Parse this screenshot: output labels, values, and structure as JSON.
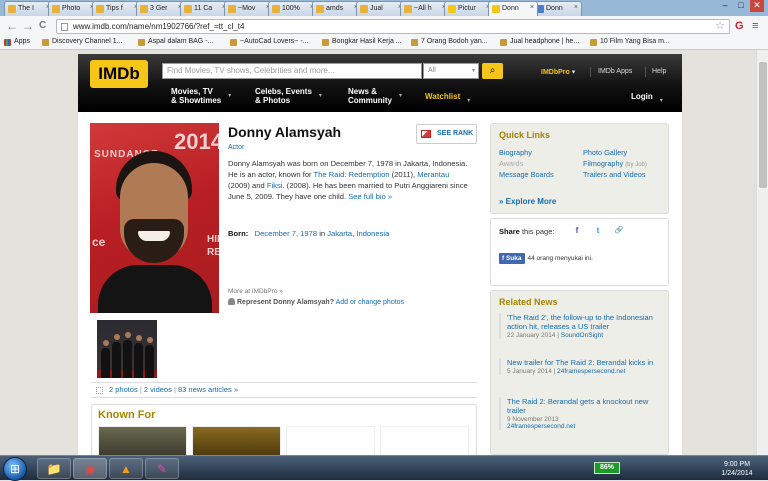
{
  "browser": {
    "tabs": [
      {
        "label": "The I",
        "fav_color": "#e8b13a"
      },
      {
        "label": "Photo",
        "fav_color": "#e8b13a"
      },
      {
        "label": "Tips f",
        "fav_color": "#e8b13a"
      },
      {
        "label": "3 Ger",
        "fav_color": "#e8b13a"
      },
      {
        "label": "11 Ca",
        "fav_color": "#e8b13a"
      },
      {
        "label": "~Mov",
        "fav_color": "#e8b13a"
      },
      {
        "label": "100%",
        "fav_color": "#e8b13a"
      },
      {
        "label": "amds",
        "fav_color": "#e8b13a"
      },
      {
        "label": "Jual",
        "fav_color": "#e8b13a"
      },
      {
        "label": "~All h",
        "fav_color": "#e8b13a"
      },
      {
        "label": "Pictur",
        "fav_color": "#f5c518"
      },
      {
        "label": "Donn",
        "fav_color": "#f5c518"
      },
      {
        "label": "Donn",
        "fav_color": "#4a7fd0"
      }
    ],
    "tab_close": "×",
    "active_tab": 11,
    "window_controls": {
      "minimize": "–",
      "maximize": "□",
      "close": "✕"
    },
    "back": "←",
    "forward": "→",
    "reload": "C",
    "url": "www.imdb.com/name/nm1902766/?ref_=tt_cl_t4",
    "star": "☆",
    "ext_icon": "G",
    "menu_icon": "≡",
    "bookmarks": [
      {
        "label": "Apps"
      },
      {
        "label": "Discovery Channel 1..."
      },
      {
        "label": "Aspal dalam BAG -..."
      },
      {
        "label": "~AutoCad Lovers~ -..."
      },
      {
        "label": "Bongkar Hasil Kerja ..."
      },
      {
        "label": "7 Orang Bodoh yan..."
      },
      {
        "label": "Jual headphone | he..."
      },
      {
        "label": "10 Film Yang Bisa m..."
      }
    ]
  },
  "imdb": {
    "logo": "IMDb",
    "search_placeholder": "Find Movies, TV shows, Celebrities and more...",
    "search_select": "All",
    "search_button": "⌕",
    "imdbpro": "IMDbPro",
    "imdbpro_caret": "▾",
    "apps": "IMDb Apps",
    "help": "Help",
    "nav": [
      {
        "line1": "Movies, TV",
        "line2": "& Showtimes"
      },
      {
        "line1": "Celebs, Events",
        "line2": "& Photos"
      },
      {
        "line1": "News &",
        "line2": "Community"
      }
    ],
    "nav_caret": "▾",
    "watchlist": "Watchlist",
    "login": "Login"
  },
  "person": {
    "name": "Donny Alamsyah",
    "role": "Actor",
    "see_rank": "SEE RANK",
    "bio_parts": {
      "p1": "Donny Alamsyah was born on December 7, 1978 in Jakarta, Indonesia. He is an actor, known for ",
      "l1": "The Raid: Redemption",
      "p2": " (2011), ",
      "l2": "Merantau",
      "p3": " (2009) and ",
      "l3": "Fiksi.",
      "p4": " (2008). He has been married to Putri Anggiareni since June 5, 2009. They have one child. ",
      "l4": "See full bio »"
    },
    "born_label": "Born:",
    "born_date": "December 7, 1978",
    "born_in": " in ",
    "born_city": "Jakarta",
    "born_comma": ", ",
    "born_country": "Indonesia",
    "more_at": "More at IMDbPro »",
    "represent": "Represent Donny Alamsyah?",
    "represent_link": "Add or change photos",
    "photo_text": {
      "sundance": "SUNDANCE",
      "year": "2014",
      "side": "HIR\nRED",
      "ce": "ce"
    },
    "media": {
      "photos": "2 photos",
      "videos": "2 videos",
      "news": "83 news articles »",
      "sep": "|"
    },
    "known_for": "Known For"
  },
  "quick_links": {
    "title": "Quick Links",
    "items": [
      {
        "label": "Biography",
        "disabled": false
      },
      {
        "label": "Awards",
        "disabled": true
      },
      {
        "label": "Message Boards",
        "disabled": false
      },
      {
        "label": "Photo Gallery",
        "disabled": false
      },
      {
        "label": "Filmography",
        "note": "(by Job)",
        "disabled": false
      },
      {
        "label": "Trailers and Videos",
        "disabled": false
      }
    ],
    "explore": "» Explore More"
  },
  "share": {
    "label": "Share",
    "suffix": " this page:",
    "fb": "f",
    "tw": "t",
    "link": "🔗",
    "like_button": "f Suka",
    "like_count": "44 orang menyukai ini."
  },
  "related_news": {
    "title": "Related News",
    "items": [
      {
        "title": "'The Raid 2', the follow-up to the Indonesian action hit, releases a US trailer",
        "date": "22 January 2014",
        "source": "SoundOnSight"
      },
      {
        "title": "New trailer for The Raid 2: Berandal kicks in",
        "date": "5 January 2014",
        "source": "24framespersecond.net"
      },
      {
        "title": "The Raid 2: Berandal gets a knockout new trailer",
        "date": "9 November 2013",
        "source": "24framespersecond.net"
      }
    ],
    "sep": "|"
  },
  "taskbar": {
    "start": "⊞",
    "apps": [
      {
        "name": "explorer",
        "glyph": "📁"
      },
      {
        "name": "chrome",
        "glyph": "◉"
      },
      {
        "name": "vlc",
        "glyph": "▲"
      },
      {
        "name": "paint",
        "glyph": "✎"
      }
    ],
    "battery": "86%",
    "time": "9:00 PM",
    "date": "1/24/2014"
  }
}
